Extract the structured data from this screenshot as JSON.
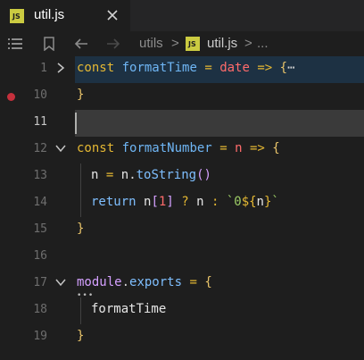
{
  "tab": {
    "badge": "JS",
    "label": "util.js"
  },
  "breadcrumb": {
    "folder": "utils",
    "sep1": ">",
    "badge": "JS",
    "file": "util.js",
    "sep2": ">",
    "more": "..."
  },
  "gutter": [
    "1",
    "10",
    "11",
    "12",
    "13",
    "14",
    "15",
    "16",
    "17",
    "18",
    "19"
  ],
  "code": {
    "l1": {
      "kw": "const",
      "name": "formatTime",
      "eq": "=",
      "param": "date",
      "arrow": "=>",
      "brace": "{",
      "ellipsis": "⋯"
    },
    "l10": {
      "brace": "}"
    },
    "l12": {
      "kw": "const",
      "name": "formatNumber",
      "eq": "=",
      "param": "n",
      "arrow": "=>",
      "brace": "{"
    },
    "l13": {
      "lhs": "n",
      "eq": "=",
      "obj": "n",
      "dot": ".",
      "method": "toString",
      "parens": "()"
    },
    "l14": {
      "kw": "return",
      "obj": "n",
      "lb": "[",
      "num": "1",
      "rb": "]",
      "q": "?",
      "v": "n",
      "colon": ":",
      "tpl_start": "`0",
      "tpl_open": "${",
      "tpl_var": "n",
      "tpl_close": "}",
      "tpl_end": "`"
    },
    "l15": {
      "brace": "}"
    },
    "l17": {
      "obj": "module",
      "dot": ".",
      "prop": "exports",
      "eq": "=",
      "brace": "{",
      "dots": "•••"
    },
    "l18": {
      "item": "formatTime"
    },
    "l19": {
      "brace": "}"
    }
  },
  "colors": {
    "keyword": "#e5b833",
    "function": "#6fb6f5",
    "param": "#ff6b6b",
    "string": "#9ccc65",
    "breakpoint": "#c5303c",
    "js_badge": "#cbcb41"
  }
}
